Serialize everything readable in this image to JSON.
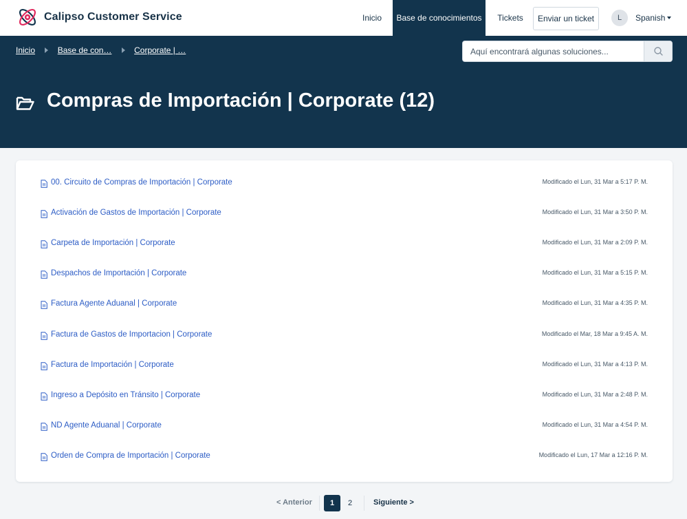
{
  "header": {
    "brand": "Calipso Customer Service",
    "nav": {
      "home": "Inicio",
      "knowledge_base": "Base de conocimientos",
      "tickets": "Tickets"
    },
    "submit_ticket": "Enviar un ticket",
    "avatar_initial": "L",
    "language": "Spanish"
  },
  "breadcrumb": [
    "Inicio",
    "Base de con…",
    "Corporate | …"
  ],
  "search": {
    "placeholder": "Aquí encontrará algunas soluciones..."
  },
  "folder": {
    "title": "Compras de Importación | Corporate (12)"
  },
  "articles": [
    {
      "title": "00. Circuito de Compras de Importación | Corporate",
      "modified": "Modificado el Lun, 31 Mar a 5:17 P. M."
    },
    {
      "title": "Activación de Gastos de Importación | Corporate",
      "modified": "Modificado el Lun, 31 Mar a 3:50 P. M."
    },
    {
      "title": "Carpeta de Importación | Corporate",
      "modified": "Modificado el Lun, 31 Mar a 2:09 P. M."
    },
    {
      "title": "Despachos de Importación | Corporate",
      "modified": "Modificado el Lun, 31 Mar a 5:15 P. M."
    },
    {
      "title": "Factura Agente Aduanal | Corporate",
      "modified": "Modificado el Lun, 31 Mar a 4:35 P. M."
    },
    {
      "title": "Factura de Gastos de Importacion | Corporate",
      "modified": "Modificado el Mar, 18 Mar a 9:45 A. M."
    },
    {
      "title": "Factura de Importación | Corporate",
      "modified": "Modificado el Lun, 31 Mar a 4:13 P. M."
    },
    {
      "title": "Ingreso a Depósito en Tránsito | Corporate",
      "modified": "Modificado el Lun, 31 Mar a 2:48 P. M."
    },
    {
      "title": "ND Agente Aduanal | Corporate",
      "modified": "Modificado el Lun, 31 Mar a 4:54 P. M."
    },
    {
      "title": "Orden de Compra de Importación | Corporate",
      "modified": "Modificado el Lun, 17 Mar a 12:16 P. M."
    }
  ],
  "pagination": {
    "prev": "< Anterior",
    "pages": [
      "1",
      "2"
    ],
    "current": "1",
    "next": "Siguiente >"
  },
  "colors": {
    "primary": "#12344d",
    "link": "#2c5cc5",
    "logo_accent": "#e02a5e"
  }
}
